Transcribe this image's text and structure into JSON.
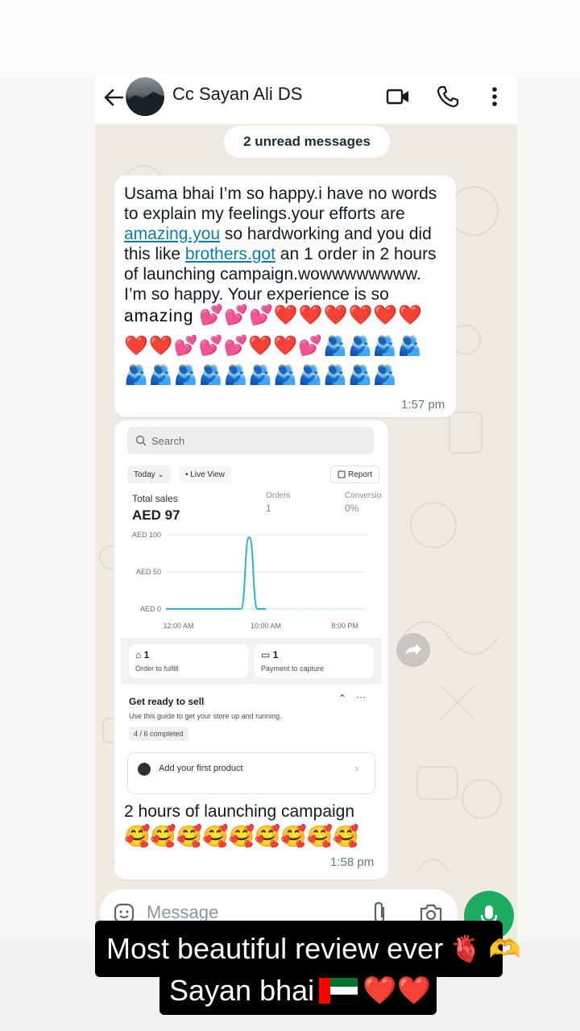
{
  "chat": {
    "contact_name": "Cc Sayan Ali DS",
    "unread_banner": "2 unread messages"
  },
  "message1": {
    "line1": "Usama bhai I’m so happy.i have no words",
    "line2": "to explain my feelings.your efforts are",
    "link1": "amazing.you",
    "line3_rest": " so hardworking and you did",
    "line4_start": "this like ",
    "link2": "brothers.got",
    "line4_rest": " an 1 order in 2 hours",
    "line5": "of launching campaign.wowwwwwwww.",
    "line6": "I’m so happy. Your experience is so",
    "line7": "amazing ",
    "emoji_line7": "💕💕💕❤️❤️❤️❤️❤️❤️",
    "emoji_line8": "❤️❤️💕💕💕❤️❤️💕🫂🫂🫂🫂",
    "emoji_line9": "🫂🫂🫂🫂🫂🫂🫂🫂🫂🫂🫂",
    "time": "1:57 pm"
  },
  "screenshot": {
    "search_placeholder": "Search",
    "filter_today": "Today ⌄",
    "filter_live": "• Live View",
    "report": "Report",
    "total_sales_label": "Total sales",
    "total_sales_value": "AED 97",
    "orders_label": "Orders",
    "orders_value": "1",
    "conversion_label": "Conversior",
    "conversion_value": "0%",
    "cards": [
      {
        "count": "1",
        "label": "Order to fulfill"
      },
      {
        "count": "1",
        "label": "Payment to capture"
      }
    ],
    "guide_title": "Get ready to sell",
    "guide_sub": "Use this guide to get your store up and running.",
    "guide_progress": "4 / 6 completed",
    "guide_item": "Add your first product",
    "chart_data": {
      "type": "line",
      "x": [
        "12:00 AM",
        "10:00 AM",
        "8:00 PM"
      ],
      "yticks": [
        "AED 100",
        "AED 50",
        "AED 0"
      ],
      "ylim": [
        0,
        100
      ],
      "series": [
        {
          "values": [
            [
              0,
              0
            ],
            [
              9,
              0
            ],
            [
              10,
              97
            ],
            [
              11,
              0
            ],
            [
              12,
              0
            ]
          ]
        }
      ],
      "xlim": [
        0,
        24
      ],
      "color": "#29b7d3"
    }
  },
  "message2": {
    "caption": "2 hours of launching campaign",
    "emoji": "🥰🥰🥰🥰🥰🥰🥰🥰🥰",
    "time": "1:58 pm"
  },
  "input": {
    "placeholder": "Message"
  },
  "overlay": {
    "line1": "Most beautiful review ever",
    "line1_emoji": "🫀 🫶",
    "line2": "Sayan bhai",
    "line2_emoji": "❤️❤️"
  },
  "colors": {
    "accent_green": "#1daa61",
    "link": "#0b7bb6",
    "chart_line": "#29b7d3"
  }
}
